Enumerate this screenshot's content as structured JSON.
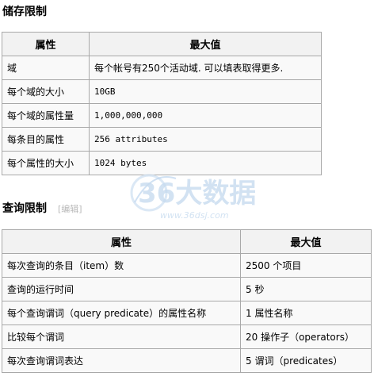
{
  "storage": {
    "title": "储存限制",
    "headers": [
      "属性",
      "最大值"
    ],
    "rows": [
      [
        "域",
        "每个帐号有250个活动域. 可以填表取得更多."
      ],
      [
        "每个域的大小",
        "10GB"
      ],
      [
        "每个域的属性量",
        "1,000,000,000"
      ],
      [
        "每条目的属性",
        "256 attributes"
      ],
      [
        "每个属性的大小",
        "1024 bytes"
      ]
    ]
  },
  "query": {
    "title": "查询限制",
    "edit_label": "[编辑]",
    "headers": [
      "属性",
      "最大值"
    ],
    "rows": [
      [
        "每次查询的条目（item）数",
        "2500 个项目"
      ],
      [
        "查询的运行时间",
        "5 秒"
      ],
      [
        "每个查询谓词（query predicate）的属性名称",
        "1 属性名称"
      ],
      [
        "比较每个谓词",
        "20 操作子（operators）"
      ],
      [
        "每次查询谓词表达",
        "5 谓词（predicates）"
      ]
    ]
  },
  "watermark": {
    "brand": "36大数据",
    "url": "www.36dsj.com",
    "color": "#6a9fd4"
  }
}
